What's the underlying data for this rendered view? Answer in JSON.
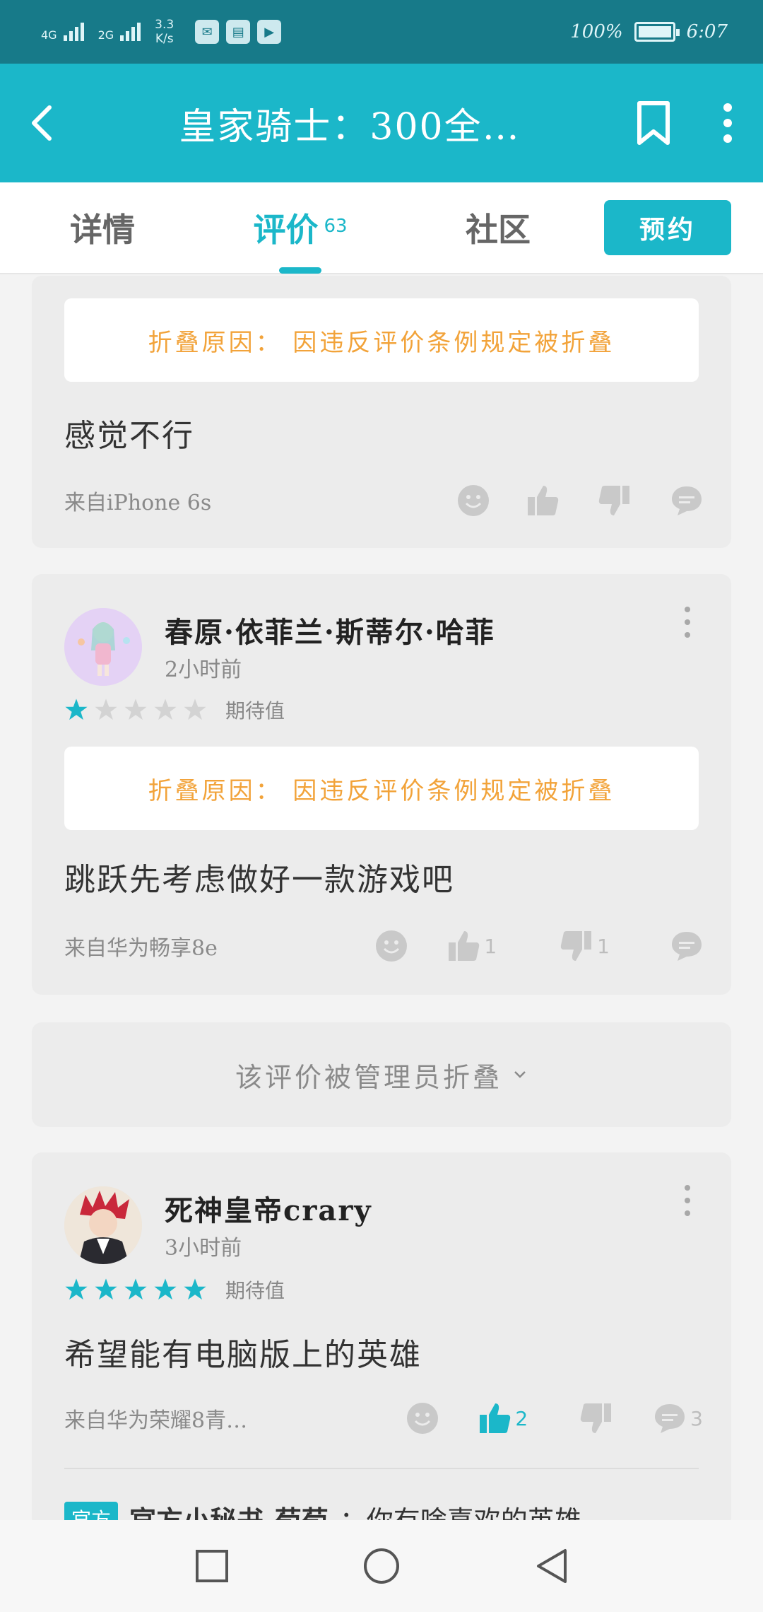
{
  "status_bar": {
    "signal1_label": "4G",
    "signal2_label": "2G",
    "speed_value": "3.3",
    "speed_unit": "K/s",
    "battery": "100%",
    "time": "6:07"
  },
  "app_bar": {
    "title": "皇家骑士：300全…"
  },
  "tabs": {
    "details": "详情",
    "reviews": "评价",
    "reviews_count": "63",
    "community": "社区",
    "reserve": "预约"
  },
  "reviews": [
    {
      "fold_notice": "折叠原因： 因违反评价条例规定被折叠",
      "text": "感觉不行",
      "source": "来自iPhone 6s"
    },
    {
      "username": "春原·依菲兰·斯蒂尔·哈菲",
      "time": "2小时前",
      "rating": 1,
      "rating_label": "期待值",
      "fold_notice": "折叠原因： 因违反评价条例规定被折叠",
      "text": "跳跃先考虑做好一款游戏吧",
      "source": "来自华为畅享8e",
      "likes": "1",
      "dislikes": "1"
    },
    {
      "collapsed_text": "该评价被管理员折叠"
    },
    {
      "username": "死神皇帝crary",
      "time": "3小时前",
      "rating": 5,
      "rating_label": "期待值",
      "text": "希望能有电脑版上的英雄",
      "source": "来自华为荣耀8青…",
      "likes": "2",
      "comments": "3",
      "reply_tag": "官方",
      "reply_name": "官方小秘书-荀荀",
      "reply_text": "：你有啥喜欢的英雄"
    }
  ],
  "colors": {
    "accent": "#1bb7c9",
    "statusbar": "#177a89",
    "warning": "#f2a33a"
  }
}
